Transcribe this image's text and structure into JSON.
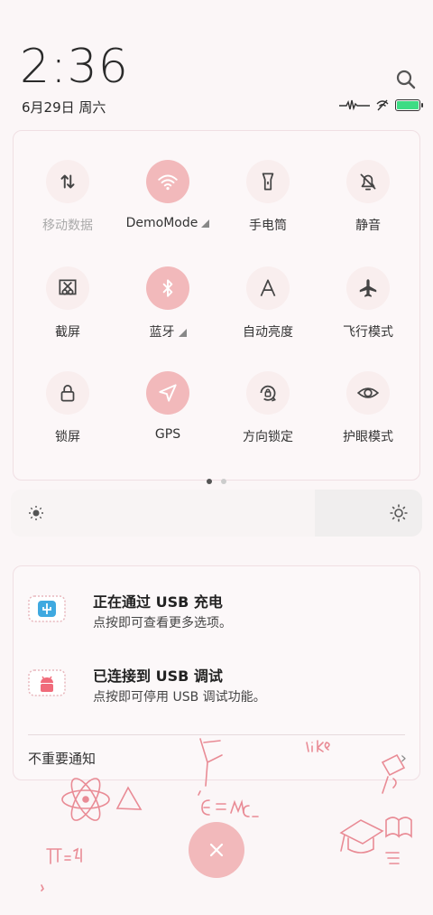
{
  "clock": {
    "time": "2:36",
    "date": "6月29日 周六"
  },
  "status": {
    "battery_color": "#3ddc84",
    "battery_level": 1.0,
    "icons": [
      "signal-wave-icon",
      "wifi-off-icon",
      "battery-icon"
    ]
  },
  "tiles": [
    {
      "label": "移动数据",
      "icon": "mobile-data-icon",
      "active": false,
      "dim": true,
      "caret": false
    },
    {
      "label": "DemoMode",
      "icon": "wifi-icon",
      "active": true,
      "dim": false,
      "caret": true
    },
    {
      "label": "手电筒",
      "icon": "flashlight-icon",
      "active": false,
      "dim": false,
      "caret": false
    },
    {
      "label": "静音",
      "icon": "bell-off-icon",
      "active": false,
      "dim": false,
      "caret": false
    },
    {
      "label": "截屏",
      "icon": "screenshot-icon",
      "active": false,
      "dim": false,
      "caret": false
    },
    {
      "label": "蓝牙",
      "icon": "bluetooth-icon",
      "active": true,
      "dim": false,
      "caret": true
    },
    {
      "label": "自动亮度",
      "icon": "auto-brightness-icon",
      "active": false,
      "dim": false,
      "caret": false
    },
    {
      "label": "飞行模式",
      "icon": "airplane-icon",
      "active": false,
      "dim": false,
      "caret": false
    },
    {
      "label": "锁屏",
      "icon": "lock-icon",
      "active": false,
      "dim": false,
      "caret": false
    },
    {
      "label": "GPS",
      "icon": "gps-icon",
      "active": true,
      "dim": false,
      "caret": false
    },
    {
      "label": "方向锁定",
      "icon": "rotation-lock-icon",
      "active": false,
      "dim": false,
      "caret": false
    },
    {
      "label": "护眼模式",
      "icon": "eye-icon",
      "active": false,
      "dim": false,
      "caret": false
    }
  ],
  "pager": {
    "pages": 2,
    "current": 1
  },
  "brightness": {
    "level": 0.74
  },
  "notifications": [
    {
      "title": "正在通过 USB 充电",
      "subtitle": "点按即可查看更多选项。",
      "icon": "usb-icon"
    },
    {
      "title": "已连接到 USB 调试",
      "subtitle": "点按即可停用 USB 调试功能。",
      "icon": "android-icon"
    }
  ],
  "unimportant_label": "不重要通知",
  "colors": {
    "accent": "#f2b9bb",
    "tile_bg": "#f9eeee"
  }
}
